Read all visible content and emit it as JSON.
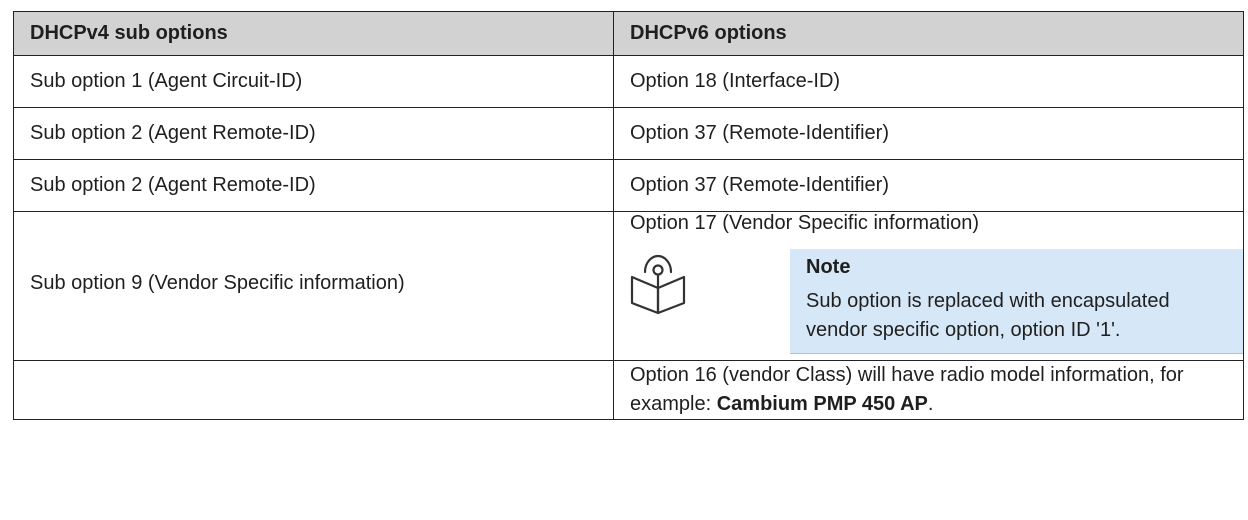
{
  "table": {
    "headers": [
      "DHCPv4 sub options",
      "DHCPv6 options"
    ],
    "rows": [
      [
        "Sub option 1 (Agent Circuit-ID)",
        "Option 18 (Interface-ID)"
      ],
      [
        "Sub option 2 (Agent Remote-ID)",
        "Option 37 (Remote-Identifier)"
      ],
      [
        "Sub option 2 (Agent Remote-ID)",
        "Option 37 (Remote-Identifier)"
      ]
    ],
    "vendor_row": {
      "v4": "Sub option 9 (Vendor Specific information)",
      "v6": "Option 17 (Vendor Specific information)"
    },
    "note": {
      "icon": "note-book-icon",
      "title": "Note",
      "text": "Sub option is replaced with encapsulated vendor specific option, option ID '1'."
    },
    "last_row": {
      "v4": "",
      "v6_text": "Option 16 (vendor Class) will have radio model information, for example: ",
      "v6_strong": "Cambium PMP 450 AP",
      "v6_end": "."
    }
  }
}
